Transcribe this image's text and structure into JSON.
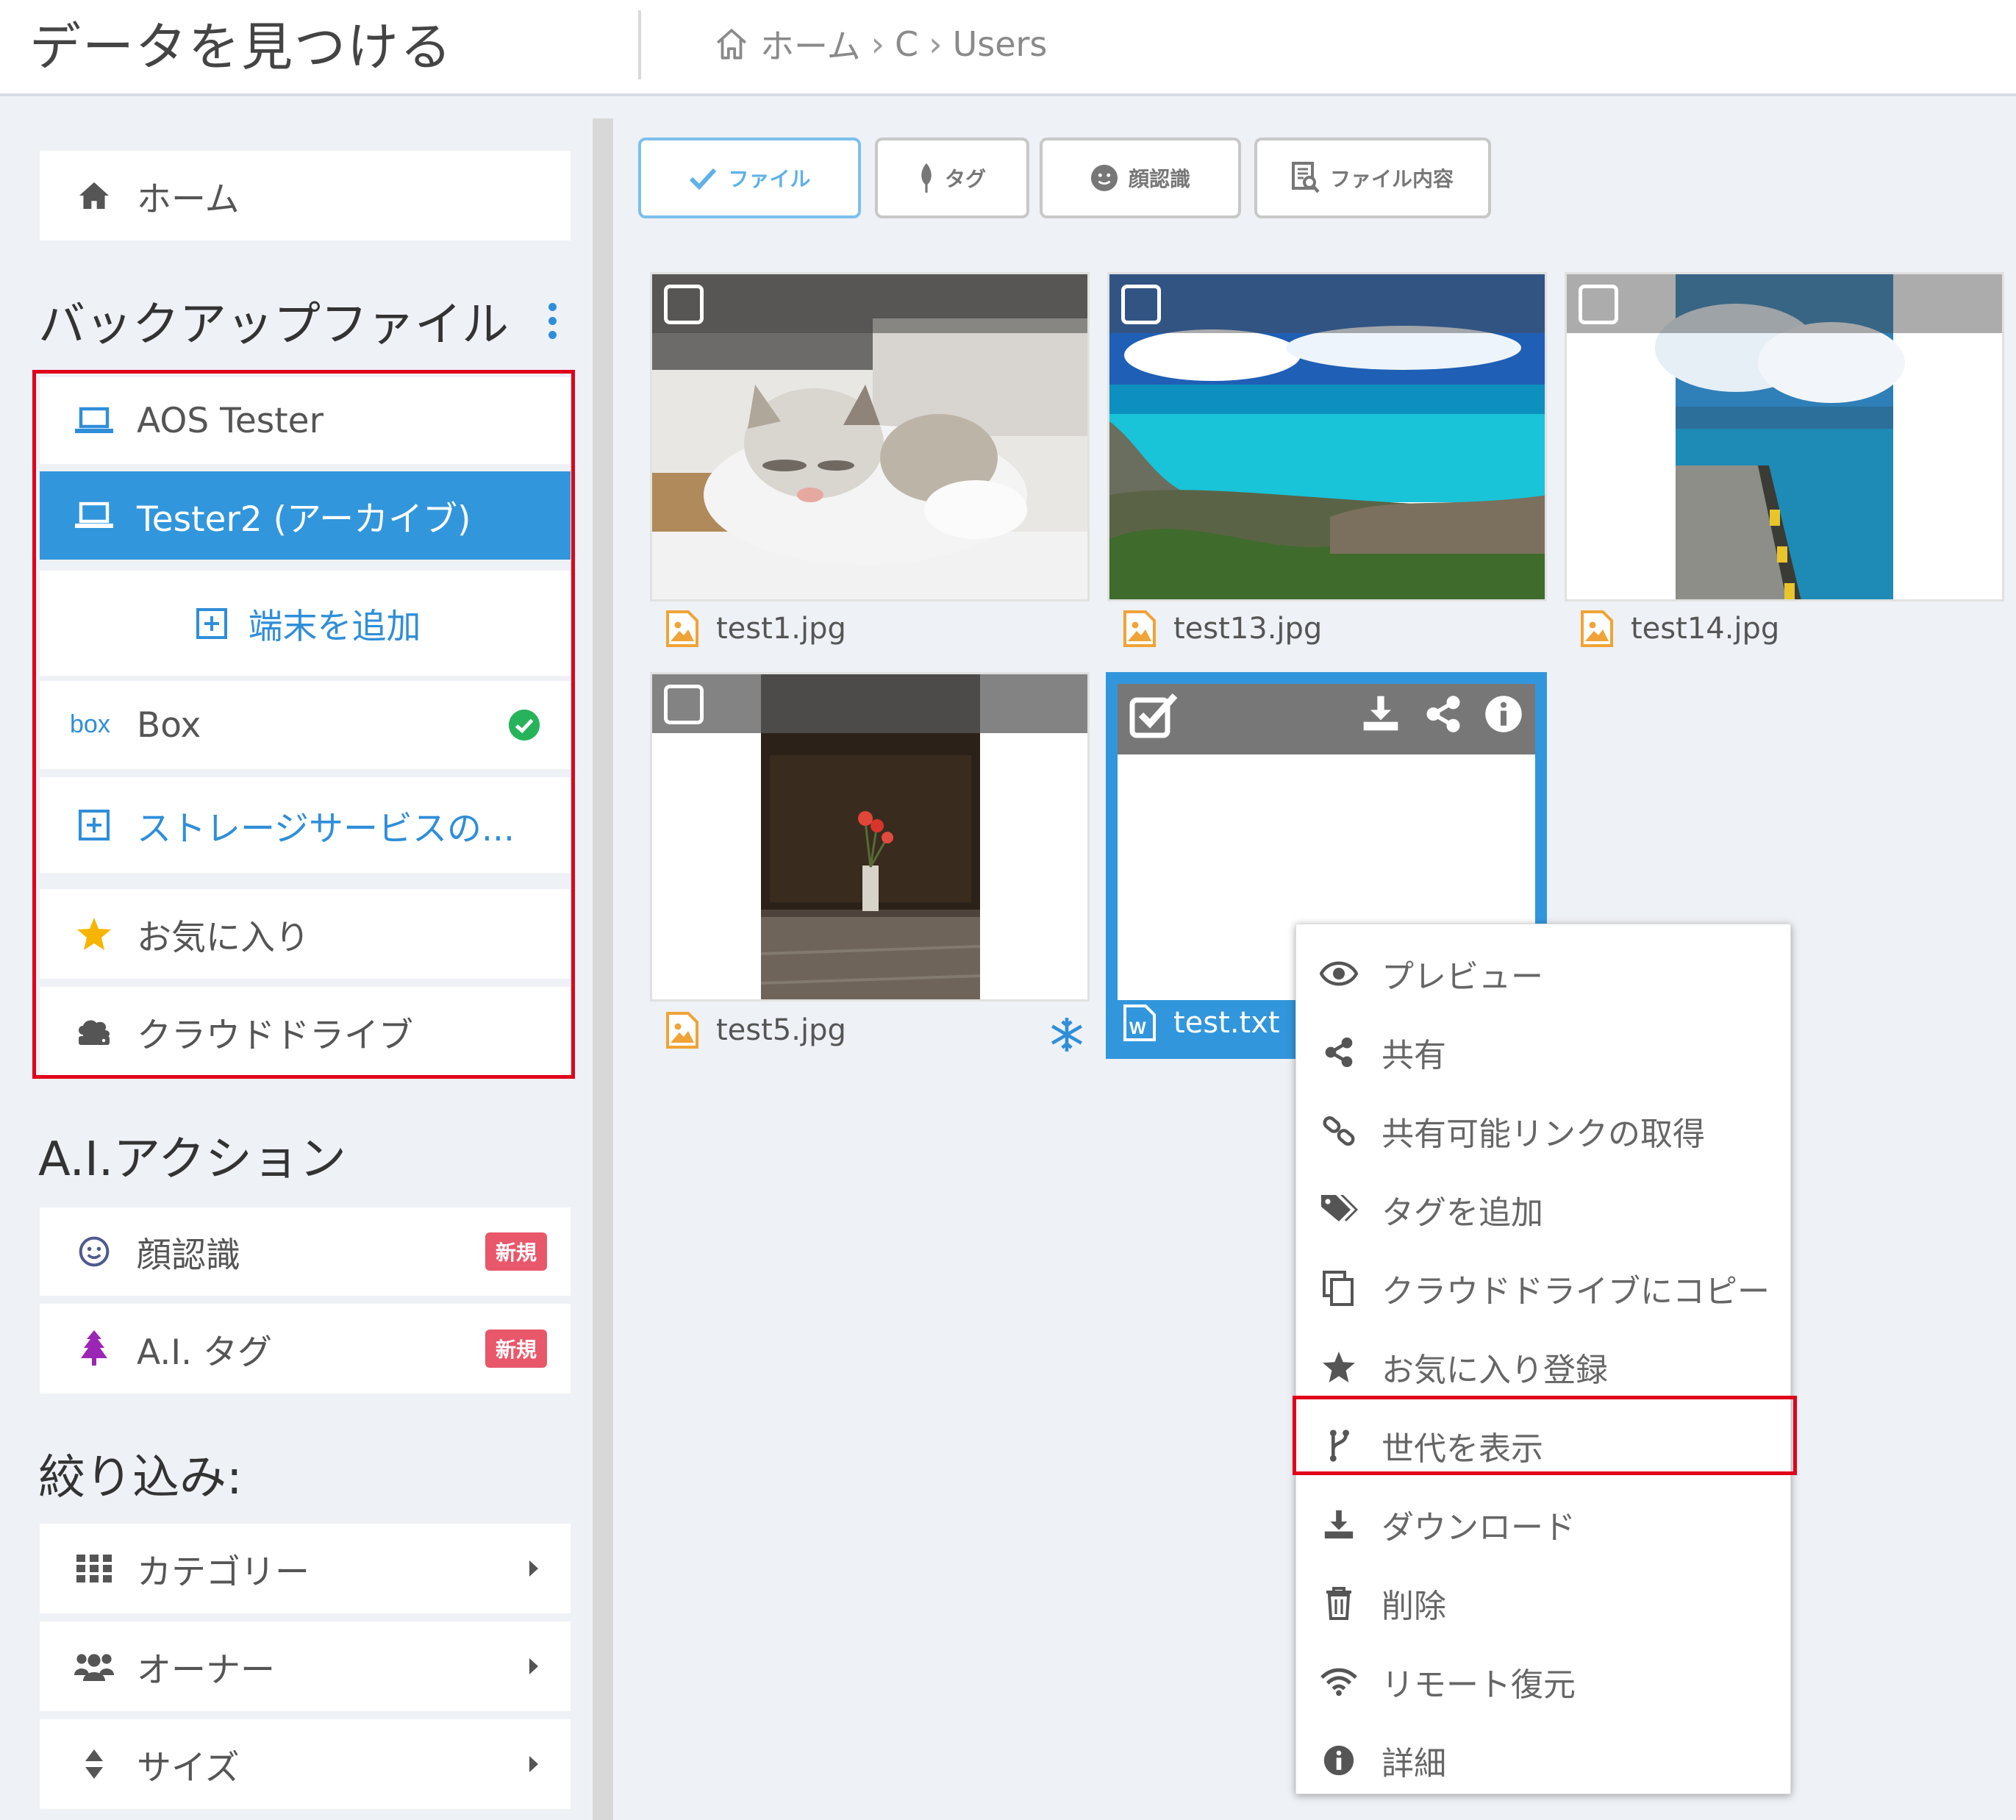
{
  "app": {
    "title": "データを見つける"
  },
  "breadcrumb": {
    "home": "ホーム",
    "items": [
      "C",
      "Users"
    ]
  },
  "sidebar": {
    "home": "ホーム",
    "backup_title": "バックアップファイル",
    "devices": [
      {
        "label": "AOS Tester"
      },
      {
        "label": "Tester2 (アーカイブ)",
        "active": true
      }
    ],
    "add_device": "端末を追加",
    "box": {
      "logo": "box",
      "label": "Box",
      "status": "connected"
    },
    "add_storage": "ストレージサービスの...",
    "favorites": "お気に入り",
    "cloud_drive": "クラウドドライブ",
    "ai_title": "A.I.アクション",
    "ai_items": [
      {
        "label": "顔認識",
        "badge": "新規"
      },
      {
        "label": "A.I. タグ",
        "badge": "新規"
      }
    ],
    "filter_title": "絞り込み:",
    "filters": [
      {
        "label": "カテゴリー"
      },
      {
        "label": "オーナー"
      },
      {
        "label": "サイズ"
      }
    ]
  },
  "tabs": [
    {
      "label": "ファイル",
      "selected": true
    },
    {
      "label": "タグ"
    },
    {
      "label": "顔認識"
    },
    {
      "label": "ファイル内容"
    }
  ],
  "files": [
    {
      "name": "test1.jpg",
      "icon": "image-file-icon"
    },
    {
      "name": "test13.jpg",
      "icon": "image-file-icon"
    },
    {
      "name": "test14.jpg",
      "icon": "image-file-icon"
    },
    {
      "name": "test5.jpg",
      "icon": "image-file-icon",
      "frozen": true
    },
    {
      "name": "test.txt",
      "icon": "word-file-icon",
      "selected": true
    }
  ],
  "context_menu": [
    {
      "label": "プレビュー",
      "icon": "eye-icon"
    },
    {
      "label": "共有",
      "icon": "share-icon"
    },
    {
      "label": "共有可能リンクの取得",
      "icon": "link-icon"
    },
    {
      "label": "タグを追加",
      "icon": "tags-icon"
    },
    {
      "label": "クラウドドライブにコピー",
      "icon": "copy-icon"
    },
    {
      "label": "お気に入り登録",
      "icon": "star-icon"
    },
    {
      "label": "世代を表示",
      "icon": "branch-icon",
      "highlighted": true
    },
    {
      "label": "ダウンロード",
      "icon": "download-icon"
    },
    {
      "label": "削除",
      "icon": "trash-icon"
    },
    {
      "label": "リモート復元",
      "icon": "wifi-icon"
    },
    {
      "label": "詳細",
      "icon": "info-icon"
    }
  ],
  "colors": {
    "accent": "#3296dc",
    "highlight_border": "#e0001a",
    "badge": "#e9576a",
    "image_icon": "#f0a336"
  }
}
